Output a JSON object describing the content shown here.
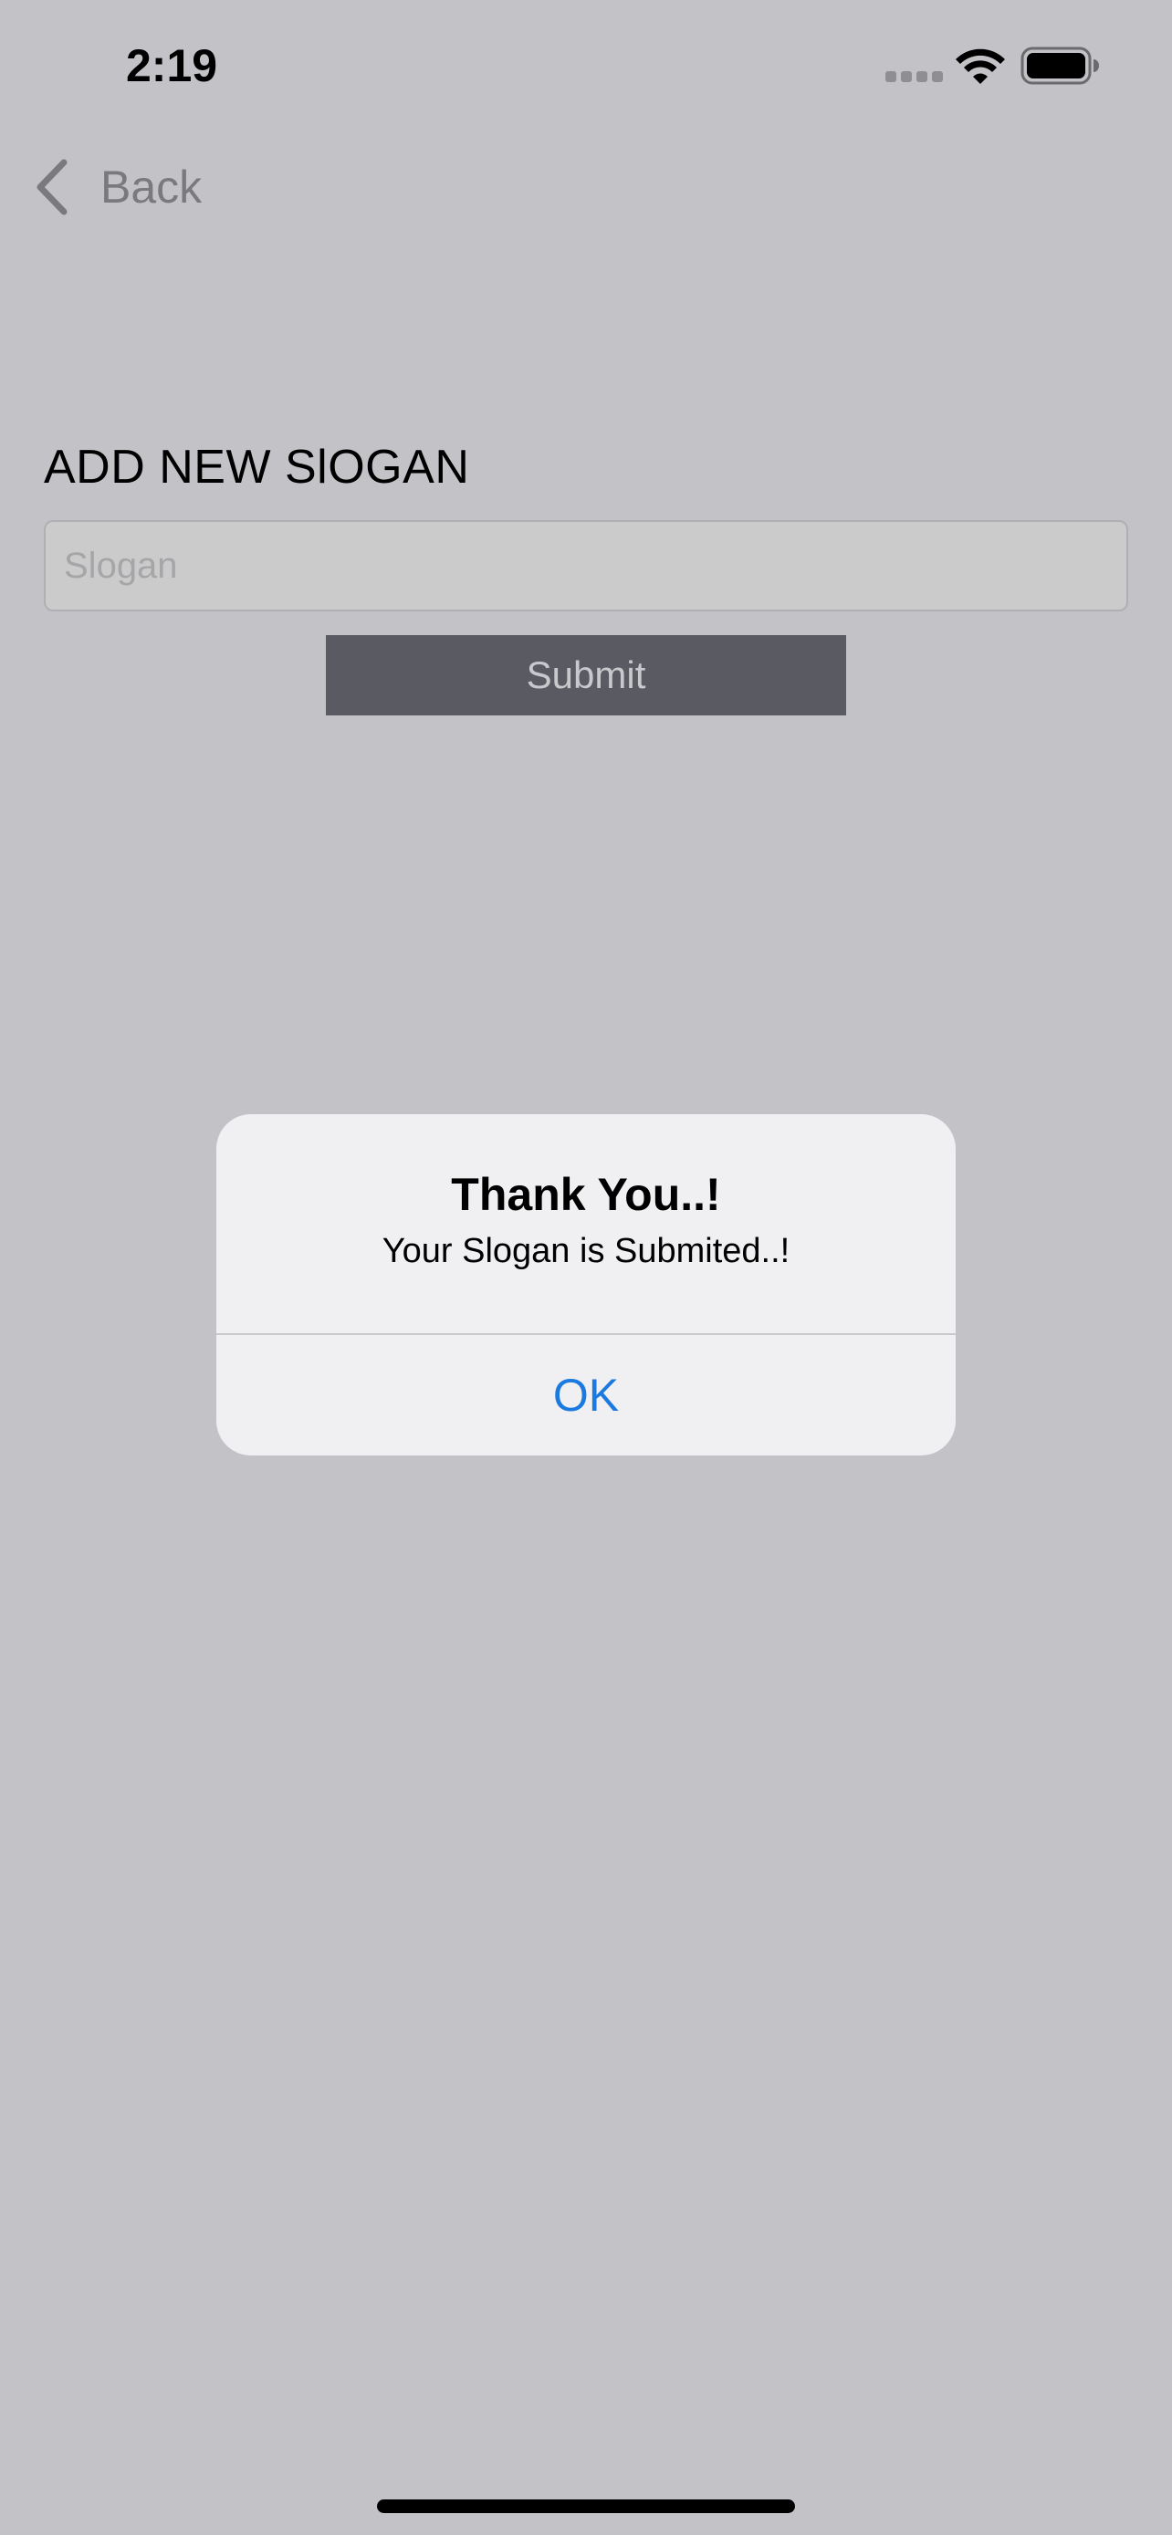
{
  "status_bar": {
    "time": "2:19",
    "signal_icon": "cellular-dots-icon",
    "wifi_icon": "wifi-icon",
    "battery_icon": "battery-full-icon"
  },
  "nav": {
    "back_icon": "chevron-left-icon",
    "back_label": "Back"
  },
  "form": {
    "title": "ADD NEW SlOGAN",
    "slogan_value": "",
    "slogan_placeholder": "Slogan",
    "submit_label": "Submit"
  },
  "alert": {
    "title": "Thank You..!",
    "message": "Your Slogan is Submited..!",
    "ok_label": "OK"
  },
  "colors": {
    "background": "#c3c2c7",
    "submit_button": "#5a5a62",
    "alert_background": "#f0f0f2",
    "alert_action": "#1a7ae0"
  }
}
